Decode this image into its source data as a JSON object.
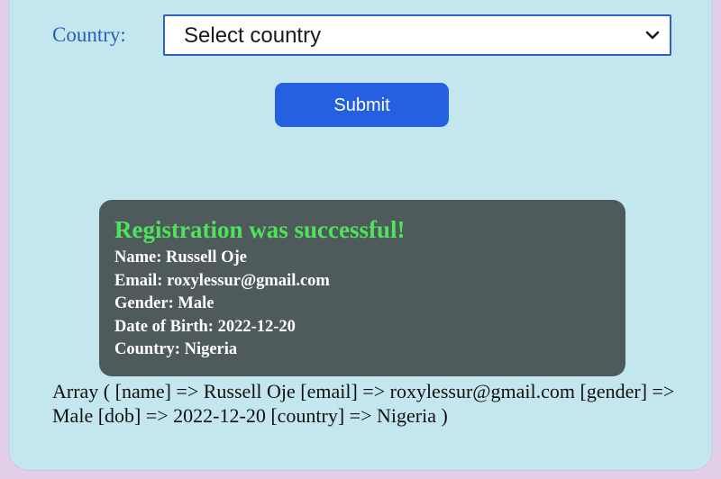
{
  "form": {
    "country_label": "Country:",
    "country_select_value": "Select country",
    "submit_label": "Submit"
  },
  "result": {
    "title": "Registration was successful!",
    "lines": [
      "Name: Russell Oje",
      "Email: roxylessur@gmail.com",
      "Gender: Male",
      "Date of Birth: 2022-12-20",
      "Country: Nigeria"
    ],
    "array_dump": "Array ( [name] => Russell Oje [email] => roxylessur@gmail.com [gender] => Male [dob] => 2022-12-20 [country] => Nigeria )"
  },
  "icons": {
    "select_arrow": "chevron-down-icon"
  },
  "colors": {
    "page_background": "#e3cfe9",
    "card_background": "#c4e6ef",
    "label_text": "#2a5fb8",
    "button_background": "#2560e0",
    "success_background": "#4f5a5c",
    "success_title": "#4fe35a"
  }
}
